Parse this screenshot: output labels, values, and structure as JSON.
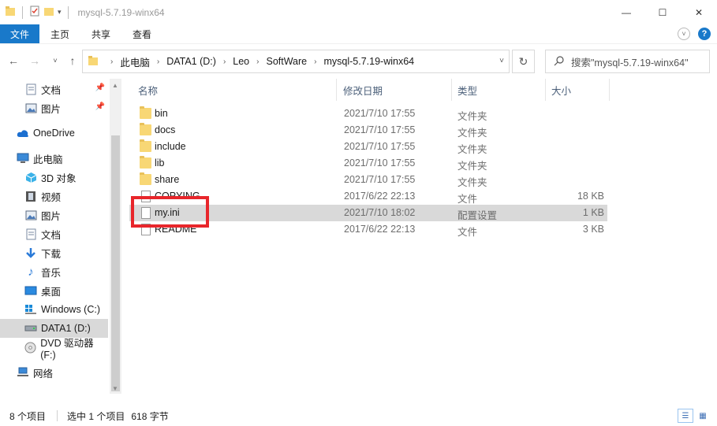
{
  "window": {
    "title": "mysql-5.7.19-winx64",
    "controls": {
      "minimize": "—",
      "maximize": "☐",
      "close": "✕"
    }
  },
  "ribbon": {
    "tabs": [
      "文件",
      "主页",
      "共享",
      "查看"
    ],
    "accent": "#1979ca"
  },
  "address": {
    "crumbs": [
      "此电脑",
      "DATA1 (D:)",
      "Leo",
      "SoftWare",
      "mysql-5.7.19-winx64"
    ],
    "search_placeholder": "搜索\"mysql-5.7.19-winx64\""
  },
  "sidebar": {
    "items": [
      {
        "label": "文档",
        "icon": "document-icon",
        "pinned": true
      },
      {
        "label": "图片",
        "icon": "picture-icon",
        "pinned": true
      },
      {
        "label": "OneDrive",
        "icon": "onedrive-cloud-icon"
      },
      {
        "label": "此电脑",
        "icon": "pc-icon"
      },
      {
        "label": "3D 对象",
        "icon": "3d-objects-icon"
      },
      {
        "label": "视频",
        "icon": "video-icon"
      },
      {
        "label": "图片",
        "icon": "picture-icon"
      },
      {
        "label": "文档",
        "icon": "document-icon"
      },
      {
        "label": "下载",
        "icon": "download-icon"
      },
      {
        "label": "音乐",
        "icon": "music-icon"
      },
      {
        "label": "桌面",
        "icon": "desktop-icon"
      },
      {
        "label": "Windows (C:)",
        "icon": "windows-drive-icon"
      },
      {
        "label": "DATA1 (D:)",
        "icon": "drive-icon",
        "selected": true
      },
      {
        "label": "DVD 驱动器 (F:)",
        "icon": "dvd-icon"
      },
      {
        "label": "网络",
        "icon": "network-icon"
      }
    ]
  },
  "columns": [
    "名称",
    "修改日期",
    "类型",
    "大小"
  ],
  "files": [
    {
      "name": "bin",
      "date": "2021/7/10 17:55",
      "type": "文件夹",
      "size": "",
      "kind": "folder"
    },
    {
      "name": "docs",
      "date": "2021/7/10 17:55",
      "type": "文件夹",
      "size": "",
      "kind": "folder"
    },
    {
      "name": "include",
      "date": "2021/7/10 17:55",
      "type": "文件夹",
      "size": "",
      "kind": "folder"
    },
    {
      "name": "lib",
      "date": "2021/7/10 17:55",
      "type": "文件夹",
      "size": "",
      "kind": "folder"
    },
    {
      "name": "share",
      "date": "2021/7/10 17:55",
      "type": "文件夹",
      "size": "",
      "kind": "folder"
    },
    {
      "name": "COPYING",
      "date": "2017/6/22 22:13",
      "type": "文件",
      "size": "18 KB",
      "kind": "file"
    },
    {
      "name": "my.ini",
      "date": "2021/7/10 18:02",
      "type": "配置设置",
      "size": "1 KB",
      "kind": "config",
      "selected": true
    },
    {
      "name": "README",
      "date": "2017/6/22 22:13",
      "type": "文件",
      "size": "3 KB",
      "kind": "file"
    }
  ],
  "status": {
    "count": "8 个项目",
    "selected": "选中 1 个项目",
    "size": "618 字节"
  }
}
